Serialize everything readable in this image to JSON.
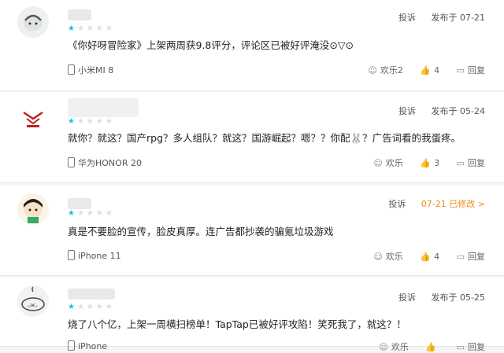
{
  "labels": {
    "report": "投诉",
    "published": "发布于",
    "edited": "已修改 >",
    "fun": "欢乐",
    "reply": "回复"
  },
  "reviews": [
    {
      "date": "07-21",
      "rating": 1,
      "text": "《你好呀冒险家》上架两周获9.8评分，评论区已被好评淹没⊙▽⊙",
      "device": "小米MI 8",
      "fun_count": "欢乐2",
      "likes": "4"
    },
    {
      "date": "05-24",
      "rating": 1,
      "text": "就你？就这？国产rpg？多人组队？就这？国游崛起？嗯？？你配🐰？广告词看的我蛋疼。",
      "device": "华为HONOR 20",
      "fun_count": "欢乐",
      "likes": "3"
    },
    {
      "date": "07-21",
      "rating": 1,
      "text": "真是不要脸的宣传，脸皮真厚。连广告都抄袭的骗氪垃圾游戏",
      "device": "iPhone 11",
      "fun_count": "欢乐",
      "likes": "4"
    },
    {
      "date": "05-25",
      "rating": 1,
      "text": "烧了八个亿，上架一周横扫榜单！TapTap已被好评攻陷！笑死我了，就这？！",
      "device": "iPhone",
      "fun_count": "欢乐",
      "likes": ""
    }
  ],
  "icons": {
    "phone": "phone-icon",
    "fun": "smiley-icon",
    "like": "thumb-up-icon",
    "reply": "reply-icon"
  },
  "colors": {
    "star_on": "#17c3d6",
    "star_off": "#dddddd",
    "edited": "#f18a1d"
  }
}
